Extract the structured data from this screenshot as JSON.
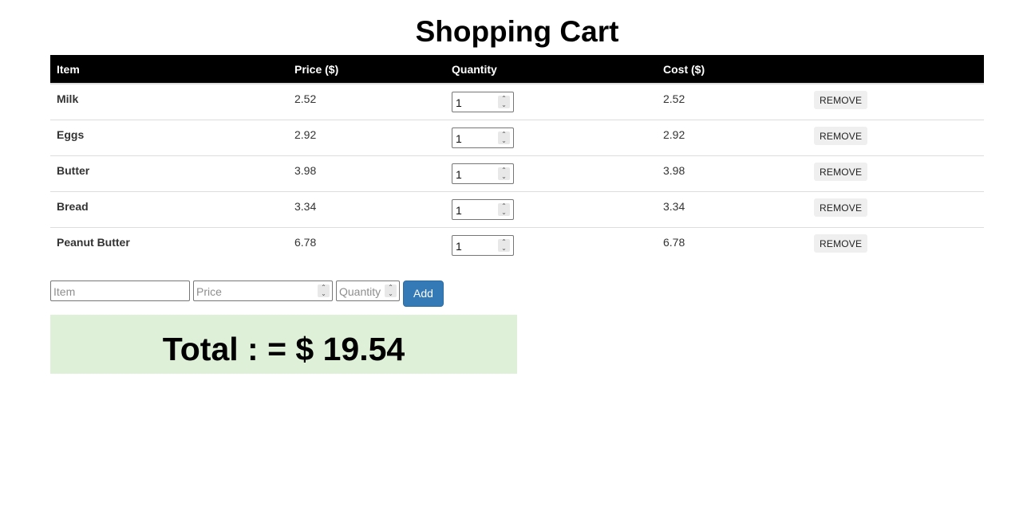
{
  "page": {
    "title": "Shopping Cart"
  },
  "table": {
    "headers": {
      "item": "Item",
      "price": "Price ($)",
      "quantity": "Quantity",
      "cost": "Cost ($)"
    },
    "rows": [
      {
        "item": "Milk",
        "price": "2.52",
        "quantity": "1",
        "cost": "2.52",
        "remove_label": "REMOVE"
      },
      {
        "item": "Eggs",
        "price": "2.92",
        "quantity": "1",
        "cost": "2.92",
        "remove_label": "REMOVE"
      },
      {
        "item": "Butter",
        "price": "3.98",
        "quantity": "1",
        "cost": "3.98",
        "remove_label": "REMOVE"
      },
      {
        "item": "Bread",
        "price": "3.34",
        "quantity": "1",
        "cost": "3.34",
        "remove_label": "REMOVE"
      },
      {
        "item": "Peanut Butter",
        "price": "6.78",
        "quantity": "1",
        "cost": "6.78",
        "remove_label": "REMOVE"
      }
    ]
  },
  "form": {
    "item_placeholder": "Item",
    "price_placeholder": "Price",
    "quantity_placeholder": "Quantity",
    "add_label": "Add"
  },
  "total": {
    "text": "Total : = $ 19.54"
  },
  "colors": {
    "header_bg": "#000000",
    "add_button": "#337ab7",
    "total_bg": "#dff0d8"
  }
}
